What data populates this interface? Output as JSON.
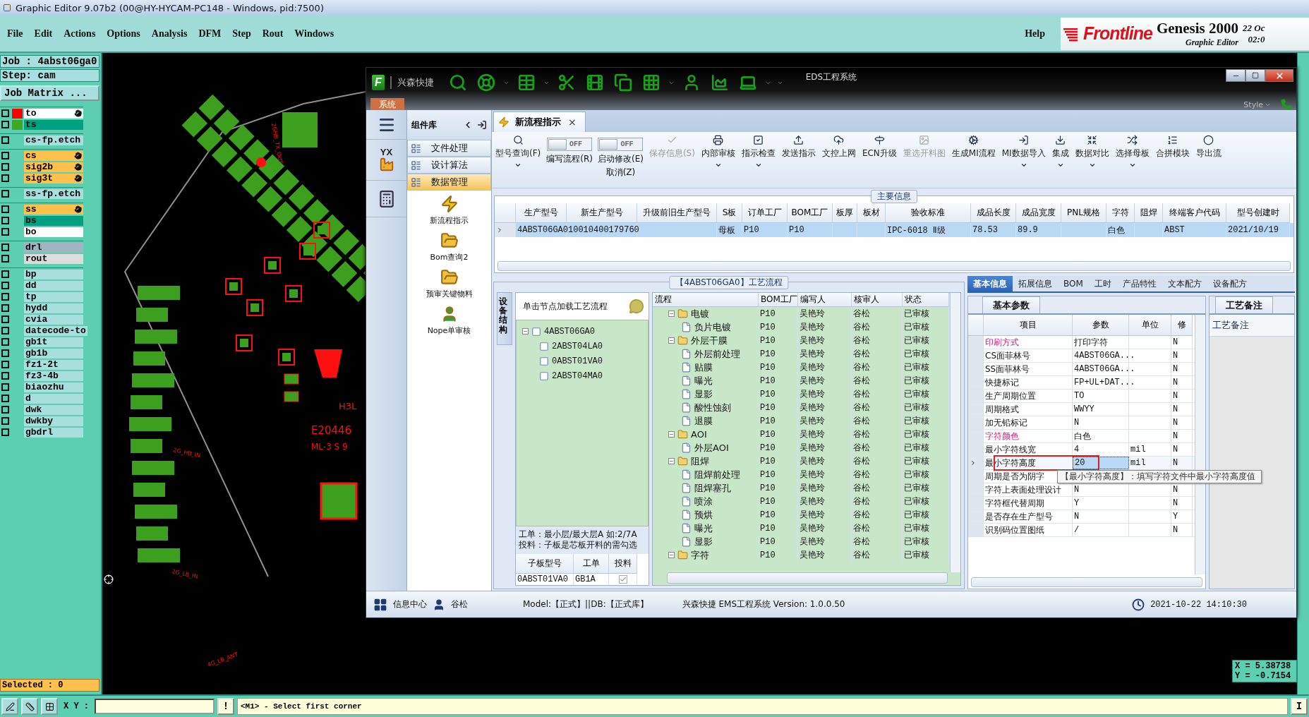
{
  "app_title": "Graphic Editor 9.07b2 (00@HY-HYCAM-PC148 - Windows, pid:7500)",
  "menu": [
    "File",
    "Edit",
    "Actions",
    "Options",
    "Analysis",
    "DFM",
    "Step",
    "Rout",
    "Windows"
  ],
  "help": "Help",
  "brand": {
    "logo": "Frontline",
    "product": "Genesis 2000",
    "subtitle": "Graphic Editor",
    "date": "22 Oc",
    "time": "02:0"
  },
  "job": {
    "job": "Job : 4abst06ga0",
    "step": "Step: cam",
    "matrix_button": "Job Matrix ..."
  },
  "layer_groups": [
    {
      "layers": [
        {
          "name": "to",
          "color": "#ffffff",
          "swatch": {
            "color": "#ff0000"
          },
          "affected": true,
          "checked": false
        },
        {
          "name": "ts",
          "color": "#00a080",
          "swatch": {
            "color": "#3caa1e"
          },
          "affected": false,
          "checked": false
        }
      ]
    },
    {
      "layers": [
        {
          "name": "cs-fp.etch",
          "color": "#a8dede",
          "affected": false,
          "checked": false
        }
      ]
    },
    {
      "layers": [
        {
          "name": "cs",
          "color": "#ffc04c",
          "affected": true,
          "checked": false
        },
        {
          "name": "sig2b",
          "color": "#ffc04c",
          "affected": true,
          "checked": false
        },
        {
          "name": "sig3t",
          "color": "#ffc04c",
          "affected": true,
          "checked": false
        }
      ]
    },
    {
      "layers": [
        {
          "name": "ss-fp.etch",
          "color": "#a8dede",
          "affected": false,
          "checked": false
        }
      ]
    },
    {
      "layers": [
        {
          "name": "ss",
          "color": "#ffc04c",
          "affected": true,
          "checked": false
        },
        {
          "name": "bs",
          "color": "#00a080",
          "affected": false,
          "checked": false
        },
        {
          "name": "bo",
          "color": "#ffffff",
          "affected": false,
          "checked": false
        }
      ]
    },
    {
      "layers": [
        {
          "name": "drl",
          "color": "#a0b4c0",
          "affected": false,
          "checked": false
        },
        {
          "name": "rout",
          "color": "#dcdcdc",
          "affected": false,
          "checked": false
        }
      ]
    },
    {
      "layers": [
        {
          "name": "bp",
          "color": "#a8dede",
          "affected": false,
          "checked": false
        },
        {
          "name": "dd",
          "color": "#a8dede",
          "affected": false,
          "checked": false
        },
        {
          "name": "tp",
          "color": "#a8dede",
          "affected": false,
          "checked": false
        },
        {
          "name": "hydd",
          "color": "#a8dede",
          "affected": false,
          "checked": false
        },
        {
          "name": "cvia",
          "color": "#a8dede",
          "affected": false,
          "checked": false
        },
        {
          "name": "datecode-to",
          "color": "#a8dede",
          "affected": false,
          "checked": false
        },
        {
          "name": "gb1t",
          "color": "#a8dede",
          "affected": false,
          "checked": false
        },
        {
          "name": "gb1b",
          "color": "#a8dede",
          "affected": false,
          "checked": false
        },
        {
          "name": "fz1-2t",
          "color": "#a8dede",
          "affected": false,
          "checked": false
        },
        {
          "name": "fz3-4b",
          "color": "#a8dede",
          "affected": false,
          "checked": false
        },
        {
          "name": "biaozhu",
          "color": "#a8dede",
          "affected": false,
          "checked": false
        },
        {
          "name": "d",
          "color": "#a8dede",
          "affected": false,
          "checked": false
        },
        {
          "name": "dwk",
          "color": "#a8dede",
          "affected": false,
          "checked": false
        },
        {
          "name": "dwkby",
          "color": "#a8dede",
          "affected": false,
          "checked": false
        },
        {
          "name": "gbdrl",
          "color": "#a8dede",
          "affected": false,
          "checked": false
        }
      ]
    }
  ],
  "selected_count": "Selected : 0",
  "pcb": {
    "labels": [
      "2GHB_TX_OUT",
      "H3L",
      "E20446",
      "ML-3 S 9",
      "2G_HB_IN",
      "2G_LB_IN",
      "4G_LB_ANT"
    ]
  },
  "coordinates": {
    "x": "X = 5.38738",
    "y": "Y = -0.7154"
  },
  "command_bar": {
    "xy_label": "X Y :",
    "warn_button": "!",
    "message": "<M1> - Select first corner",
    "right_button": "I"
  },
  "eds": {
    "logo": "F",
    "brand": "兴森快捷",
    "title": "EDS工程系统",
    "system_tab": "系统",
    "style": "Style",
    "factory_label": "YX",
    "library": {
      "title": "组件库",
      "modules": [
        {
          "label": "文件处理",
          "selected": false
        },
        {
          "label": "设计算法",
          "selected": false
        },
        {
          "label": "数据管理",
          "selected": true
        }
      ],
      "tools": [
        "新流程指示",
        "Bom查询2",
        "预审关键物料",
        "Nope单审核"
      ]
    },
    "doc_tab": {
      "label": "新流程指示",
      "close": "×"
    },
    "ribbon": [
      {
        "kind": "button",
        "label": "型号查询(F)",
        "menu": true,
        "disabled": false
      },
      {
        "kind": "toggle",
        "switch": "OFF",
        "on": false,
        "label": "编写流程(R)"
      },
      {
        "kind": "toggle",
        "switch": "OFF",
        "on": false,
        "label": "启动修改(E)",
        "label2": "取消(Z)"
      },
      {
        "kind": "button",
        "label": "保存信息(S)",
        "menu": false,
        "disabled": true
      },
      {
        "kind": "button",
        "label": "内部审核",
        "menu": true,
        "disabled": false
      },
      {
        "kind": "button",
        "label": "指示检查",
        "menu": true,
        "disabled": false
      },
      {
        "kind": "button",
        "label": "发送指示",
        "menu": false,
        "disabled": false
      },
      {
        "kind": "button",
        "label": "文控上网",
        "menu": false,
        "disabled": false
      },
      {
        "kind": "button",
        "label": "ECN升级",
        "menu": false,
        "disabled": false
      },
      {
        "kind": "button",
        "label": "重选开料图",
        "menu": false,
        "disabled": true
      },
      {
        "kind": "button",
        "label": "生成MI流程",
        "menu": false,
        "disabled": false
      },
      {
        "kind": "button",
        "label": "MI数据导入",
        "menu": true,
        "disabled": false
      },
      {
        "kind": "button",
        "label": "集成",
        "menu": true,
        "disabled": false
      },
      {
        "kind": "button",
        "label": "数据对比",
        "menu": true,
        "disabled": false
      },
      {
        "kind": "button",
        "label": "选择母板",
        "menu": true,
        "disabled": false
      },
      {
        "kind": "button",
        "label": "合拼模块",
        "menu": false,
        "disabled": false
      },
      {
        "kind": "button",
        "label": "导出流",
        "menu": false,
        "disabled": false
      }
    ],
    "main_info": {
      "title": "主要信息",
      "columns": [
        "生产型号",
        "新生产型号",
        "升级前旧生产型号",
        "S板",
        "订单工厂",
        "BOM工厂",
        "板厚",
        "板材",
        "验收标准",
        "成品长度",
        "成品宽度",
        "PNL规格",
        "字符",
        "阻焊",
        "终端客户代码",
        "型号创建时"
      ],
      "rows": [
        {
          "selected": true,
          "cells": [
            "4ABST06GA0",
            "10010400179760",
            null,
            "母板",
            "P10",
            "P10",
            null,
            null,
            "IPC-6018 Ⅱ级",
            "78.53",
            "89.9",
            null,
            "白色",
            null,
            "ABST",
            "2021/10/19"
          ]
        }
      ]
    },
    "process": {
      "title": "【4ABST06GA0】工艺流程",
      "side_tab": "设备结构",
      "tree_hint": "单击节点加载工艺流程",
      "tree": [
        {
          "label": "4ABST06GA0",
          "expanded": true,
          "children": [
            {
              "label": "2ABST04LA0"
            },
            {
              "label": "0ABST01VA0"
            },
            {
              "label": "2ABST04MA0"
            }
          ]
        }
      ],
      "notes": [
        "工单：最小层/最大层A 如:2/7A",
        "投料：子板是芯板开料的需勾选"
      ],
      "sub_table": {
        "columns": [
          "子板型号",
          "工单",
          "投料"
        ],
        "rows": [
          {
            "board": "0ABST01VA0",
            "order": "GB1A",
            "feed": true
          }
        ]
      },
      "flow_columns": [
        "流程",
        "BOM工厂",
        "编写人",
        "核审人",
        "状态"
      ],
      "flow": [
        {
          "name": "电镀",
          "expanded": true,
          "bom": "P10",
          "writer": "吴艳玲",
          "reviewer": "谷松",
          "status": "已审核",
          "children": [
            {
              "name": "负片电镀",
              "bom": "P10",
              "writer": "吴艳玲",
              "reviewer": "谷松",
              "status": "已审核"
            }
          ]
        },
        {
          "name": "外层干膜",
          "expanded": true,
          "bom": "P10",
          "writer": "吴艳玲",
          "reviewer": "谷松",
          "status": "已审核",
          "children": [
            {
              "name": "外层前处理",
              "bom": "P10",
              "writer": "吴艳玲",
              "reviewer": "谷松",
              "status": "已审核"
            },
            {
              "name": "贴膜",
              "bom": "P10",
              "writer": "吴艳玲",
              "reviewer": "谷松",
              "status": "已审核"
            },
            {
              "name": "曝光",
              "bom": "P10",
              "writer": "吴艳玲",
              "reviewer": "谷松",
              "status": "已审核"
            },
            {
              "name": "显影",
              "bom": "P10",
              "writer": "吴艳玲",
              "reviewer": "谷松",
              "status": "已审核"
            },
            {
              "name": "酸性蚀刻",
              "bom": "P10",
              "writer": "吴艳玲",
              "reviewer": "谷松",
              "status": "已审核"
            },
            {
              "name": "退膜",
              "bom": "P10",
              "writer": "吴艳玲",
              "reviewer": "谷松",
              "status": "已审核"
            }
          ]
        },
        {
          "name": "AOI",
          "expanded": true,
          "bom": "P10",
          "writer": "吴艳玲",
          "reviewer": "谷松",
          "status": "已审核",
          "children": [
            {
              "name": "外层AOI",
              "bom": "P10",
              "writer": "吴艳玲",
              "reviewer": "谷松",
              "status": "已审核"
            }
          ]
        },
        {
          "name": "阻焊",
          "expanded": true,
          "bom": "P10",
          "writer": "吴艳玲",
          "reviewer": "谷松",
          "status": "已审核",
          "children": [
            {
              "name": "阻焊前处理",
              "bom": "P10",
              "writer": "吴艳玲",
              "reviewer": "谷松",
              "status": "已审核"
            },
            {
              "name": "阻焊塞孔",
              "bom": "P10",
              "writer": "吴艳玲",
              "reviewer": "谷松",
              "status": "已审核"
            },
            {
              "name": "喷涂",
              "bom": "P10",
              "writer": "吴艳玲",
              "reviewer": "谷松",
              "status": "已审核"
            },
            {
              "name": "预烘",
              "bom": "P10",
              "writer": "吴艳玲",
              "reviewer": "谷松",
              "status": "已审核"
            },
            {
              "name": "曝光",
              "bom": "P10",
              "writer": "吴艳玲",
              "reviewer": "谷松",
              "status": "已审核"
            },
            {
              "name": "显影",
              "bom": "P10",
              "writer": "吴艳玲",
              "reviewer": "谷松",
              "status": "已审核"
            }
          ]
        },
        {
          "name": "字符",
          "expanded": true,
          "bom": "P10",
          "writer": "吴艳玲",
          "reviewer": "谷松",
          "status": "已审核"
        }
      ]
    },
    "detail_tabs": [
      {
        "label": "基本信息",
        "selected": true
      },
      {
        "label": "拓展信息",
        "selected": false
      },
      {
        "label": "BOM",
        "selected": false
      },
      {
        "label": "工时",
        "selected": false
      },
      {
        "label": "产品特性",
        "selected": false
      },
      {
        "label": "文本配方",
        "selected": false
      },
      {
        "label": "设备配方",
        "selected": false
      }
    ],
    "params": {
      "tab": "基本参数",
      "columns": [
        "项目",
        "参数",
        "单位",
        "修"
      ],
      "rows": [
        {
          "item": "印刷方式",
          "value": "打印字符",
          "modified": "N",
          "required": true,
          "selected": false
        },
        {
          "item": "CS面菲林号",
          "value": "4ABST06GA...",
          "modified": "N",
          "required": false,
          "selected": false
        },
        {
          "item": "SS面菲林号",
          "value": "4ABST06GA...",
          "modified": "N",
          "required": false,
          "selected": false
        },
        {
          "item": "快捷标记",
          "value": "FP+UL+DAT...",
          "modified": "N",
          "required": false,
          "selected": false
        },
        {
          "item": "生产周期位置",
          "value": "TO",
          "modified": "N",
          "required": false,
          "selected": false
        },
        {
          "item": "周期格式",
          "value": "WWYY",
          "modified": "N",
          "required": false,
          "selected": false
        },
        {
          "item": "加无铅标记",
          "value": "N",
          "modified": "N",
          "required": false,
          "selected": false
        },
        {
          "item": "字符颜色",
          "value": "白色",
          "modified": "N",
          "required": true,
          "selected": false
        },
        {
          "item": "最小字符线宽",
          "value": "4",
          "unit": "mil",
          "modified": "N",
          "required": false,
          "selected": false
        },
        {
          "item": "最小字符高度",
          "value": "20",
          "unit": "mil",
          "modified": "N",
          "required": false,
          "selected": true
        },
        {
          "item": "周期是否为阴字",
          "required": false,
          "selected": false
        },
        {
          "item": "字符上表面处理设计",
          "value": "N",
          "modified": "N",
          "required": false,
          "selected": false
        },
        {
          "item": "字符框代替周期",
          "value": "Y",
          "modified": "N",
          "required": false,
          "selected": false
        },
        {
          "item": "是否存在生产型号",
          "value": "N",
          "modified": "Y",
          "required": false,
          "selected": false
        },
        {
          "item": "识别码位置图纸",
          "value": "/",
          "modified": "N",
          "required": false,
          "selected": false
        }
      ],
      "tooltip": "【最小字符高度】：填写字符文件中最小字符高度值"
    },
    "remarks": {
      "tab": "工艺备注",
      "label": "工艺备注"
    },
    "status": {
      "info": "信息中心",
      "user": "谷松",
      "model": "Model:【正式】||DB:【正式库】",
      "version": "兴森快捷 EMS工程系统 Version: 1.0.0.50",
      "clock": "2021-10-22 14:10:30"
    }
  }
}
